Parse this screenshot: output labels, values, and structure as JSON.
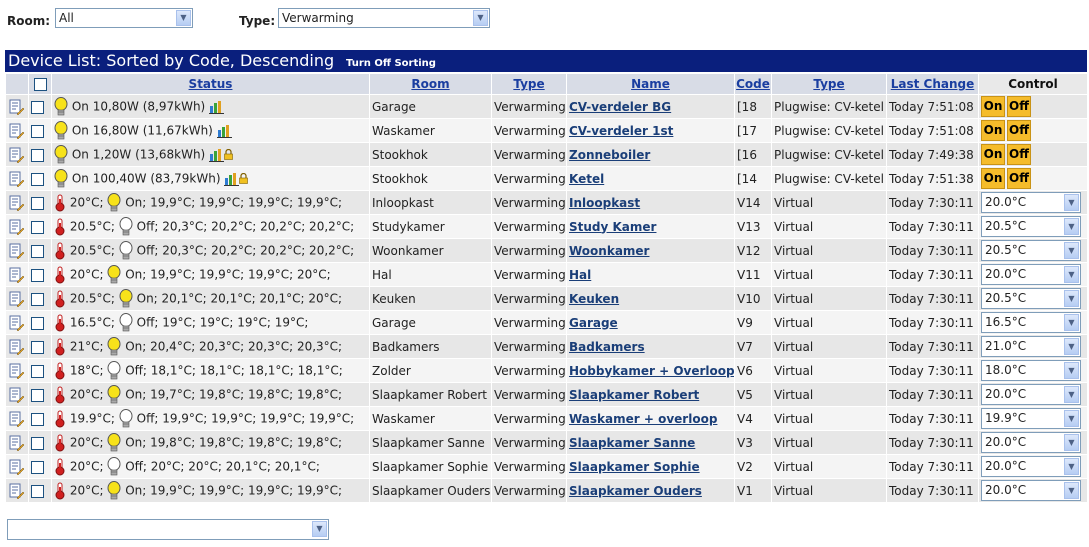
{
  "filters": {
    "room_label": "Room:",
    "room_value": "All",
    "type_label": "Type:",
    "type_value": "Verwarming"
  },
  "title": {
    "text": "Device List: Sorted by Code, Descending",
    "sort_link": "Turn Off Sorting"
  },
  "columns": {
    "status": "Status",
    "room": "Room",
    "type": "Type",
    "name": "Name",
    "code": "Code",
    "type2": "Type",
    "last_change": "Last Change",
    "control": "Control"
  },
  "buttons": {
    "on": "On",
    "off": "Off"
  },
  "rows": [
    {
      "kind": "power",
      "status": "On 10,80W (8,97kWh)",
      "lock": false,
      "room": "Garage",
      "type": "Verwarming",
      "name": "CV-verdeler BG",
      "code": "[18",
      "dtype": "Plugwise: CV-ketel",
      "last": "Today 7:51:08"
    },
    {
      "kind": "power",
      "status": "On 16,80W (11,67kWh)",
      "lock": false,
      "room": "Waskamer",
      "type": "Verwarming",
      "name": "CV-verdeler 1st",
      "code": "[17",
      "dtype": "Plugwise: CV-ketel",
      "last": "Today 7:51:08"
    },
    {
      "kind": "power",
      "status": "On 1,20W (13,68kWh)",
      "lock": true,
      "room": "Stookhok",
      "type": "Verwarming",
      "name": "Zonneboiler",
      "code": "[16",
      "dtype": "Plugwise: CV-ketel",
      "last": "Today 7:49:38"
    },
    {
      "kind": "power",
      "status": "On 100,40W (83,79kWh)",
      "lock": true,
      "room": "Stookhok",
      "type": "Verwarming",
      "name": "Ketel",
      "code": "[14",
      "dtype": "Plugwise: CV-ketel",
      "last": "Today 7:51:38"
    },
    {
      "kind": "thermo",
      "temp": "20°C;",
      "on": true,
      "status": "On; 19,9°C; 19,9°C; 19,9°C; 19,9°C;",
      "room": "Inloopkast",
      "type": "Verwarming",
      "name": "Inloopkast",
      "code": "V14",
      "dtype": "Virtual",
      "last": "Today 7:30:11",
      "setpoint": "20.0°C"
    },
    {
      "kind": "thermo",
      "temp": "20.5°C;",
      "on": false,
      "status": "Off; 20,3°C; 20,2°C; 20,2°C; 20,2°C;",
      "room": "Studykamer",
      "type": "Verwarming",
      "name": "Study Kamer",
      "code": "V13",
      "dtype": "Virtual",
      "last": "Today 7:30:11",
      "setpoint": "20.5°C"
    },
    {
      "kind": "thermo",
      "temp": "20.5°C;",
      "on": false,
      "status": "Off; 20,3°C; 20,2°C; 20,2°C; 20,2°C;",
      "room": "Woonkamer",
      "type": "Verwarming",
      "name": "Woonkamer",
      "code": "V12",
      "dtype": "Virtual",
      "last": "Today 7:30:11",
      "setpoint": "20.5°C"
    },
    {
      "kind": "thermo",
      "temp": "20°C;",
      "on": true,
      "status": "On; 19,9°C; 19,9°C; 19,9°C; 20°C;",
      "room": "Hal",
      "type": "Verwarming",
      "name": "Hal",
      "code": "V11",
      "dtype": "Virtual",
      "last": "Today 7:30:11",
      "setpoint": "20.0°C"
    },
    {
      "kind": "thermo",
      "temp": "20.5°C;",
      "on": true,
      "status": "On; 20,1°C; 20,1°C; 20,1°C; 20°C;",
      "room": "Keuken",
      "type": "Verwarming",
      "name": "Keuken",
      "code": "V10",
      "dtype": "Virtual",
      "last": "Today 7:30:11",
      "setpoint": "20.5°C"
    },
    {
      "kind": "thermo",
      "temp": "16.5°C;",
      "on": false,
      "status": "Off; 19°C; 19°C; 19°C; 19°C;",
      "room": "Garage",
      "type": "Verwarming",
      "name": "Garage",
      "code": "V9",
      "dtype": "Virtual",
      "last": "Today 7:30:11",
      "setpoint": "16.5°C"
    },
    {
      "kind": "thermo",
      "temp": "21°C;",
      "on": true,
      "status": "On; 20,4°C; 20,3°C; 20,3°C; 20,3°C;",
      "room": "Badkamers",
      "type": "Verwarming",
      "name": "Badkamers",
      "code": "V7",
      "dtype": "Virtual",
      "last": "Today 7:30:11",
      "setpoint": "21.0°C"
    },
    {
      "kind": "thermo",
      "temp": "18°C;",
      "on": false,
      "status": "Off; 18,1°C; 18,1°C; 18,1°C; 18,1°C;",
      "room": "Zolder",
      "type": "Verwarming",
      "name": "Hobbykamer + Overloop",
      "code": "V6",
      "dtype": "Virtual",
      "last": "Today 7:30:11",
      "setpoint": "18.0°C"
    },
    {
      "kind": "thermo",
      "temp": "20°C;",
      "on": true,
      "status": "On; 19,7°C; 19,8°C; 19,8°C; 19,8°C;",
      "room": "Slaapkamer Robert",
      "type": "Verwarming",
      "name": "Slaapkamer Robert",
      "code": "V5",
      "dtype": "Virtual",
      "last": "Today 7:30:11",
      "setpoint": "20.0°C"
    },
    {
      "kind": "thermo",
      "temp": "19.9°C;",
      "on": false,
      "status": "Off; 19,9°C; 19,9°C; 19,9°C; 19,9°C;",
      "room": "Waskamer",
      "type": "Verwarming",
      "name": "Waskamer + overloop",
      "code": "V4",
      "dtype": "Virtual",
      "last": "Today 7:30:11",
      "setpoint": "19.9°C"
    },
    {
      "kind": "thermo",
      "temp": "20°C;",
      "on": true,
      "status": "On; 19,8°C; 19,8°C; 19,8°C; 19,8°C;",
      "room": "Slaapkamer Sanne",
      "type": "Verwarming",
      "name": "Slaapkamer Sanne",
      "code": "V3",
      "dtype": "Virtual",
      "last": "Today 7:30:11",
      "setpoint": "20.0°C"
    },
    {
      "kind": "thermo",
      "temp": "20°C;",
      "on": false,
      "status": "Off; 20°C; 20°C; 20,1°C; 20,1°C;",
      "room": "Slaapkamer Sophie",
      "type": "Verwarming",
      "name": "Slaapkamer Sophie",
      "code": "V2",
      "dtype": "Virtual",
      "last": "Today 7:30:11",
      "setpoint": "20.0°C"
    },
    {
      "kind": "thermo",
      "temp": "20°C;",
      "on": true,
      "status": "On; 19,9°C; 19,9°C; 19,9°C; 19,9°C;",
      "room": "Slaapkamer Ouders",
      "type": "Verwarming",
      "name": "Slaapkamer Ouders",
      "code": "V1",
      "dtype": "Virtual",
      "last": "Today 7:30:11",
      "setpoint": "20.0°C"
    }
  ],
  "bottom_select": {
    "value": ""
  },
  "colors": {
    "header_bg": "#0a1f7d",
    "button_bg": "#f5bc2b",
    "bulb_on": "#f7e21a",
    "link": "#1a3e78"
  },
  "icons": {
    "edit": "edit-icon",
    "bulb": "bulb-icon",
    "graph": "graph-icon",
    "lock": "lock-icon",
    "thermostat": "thermostat-icon"
  }
}
